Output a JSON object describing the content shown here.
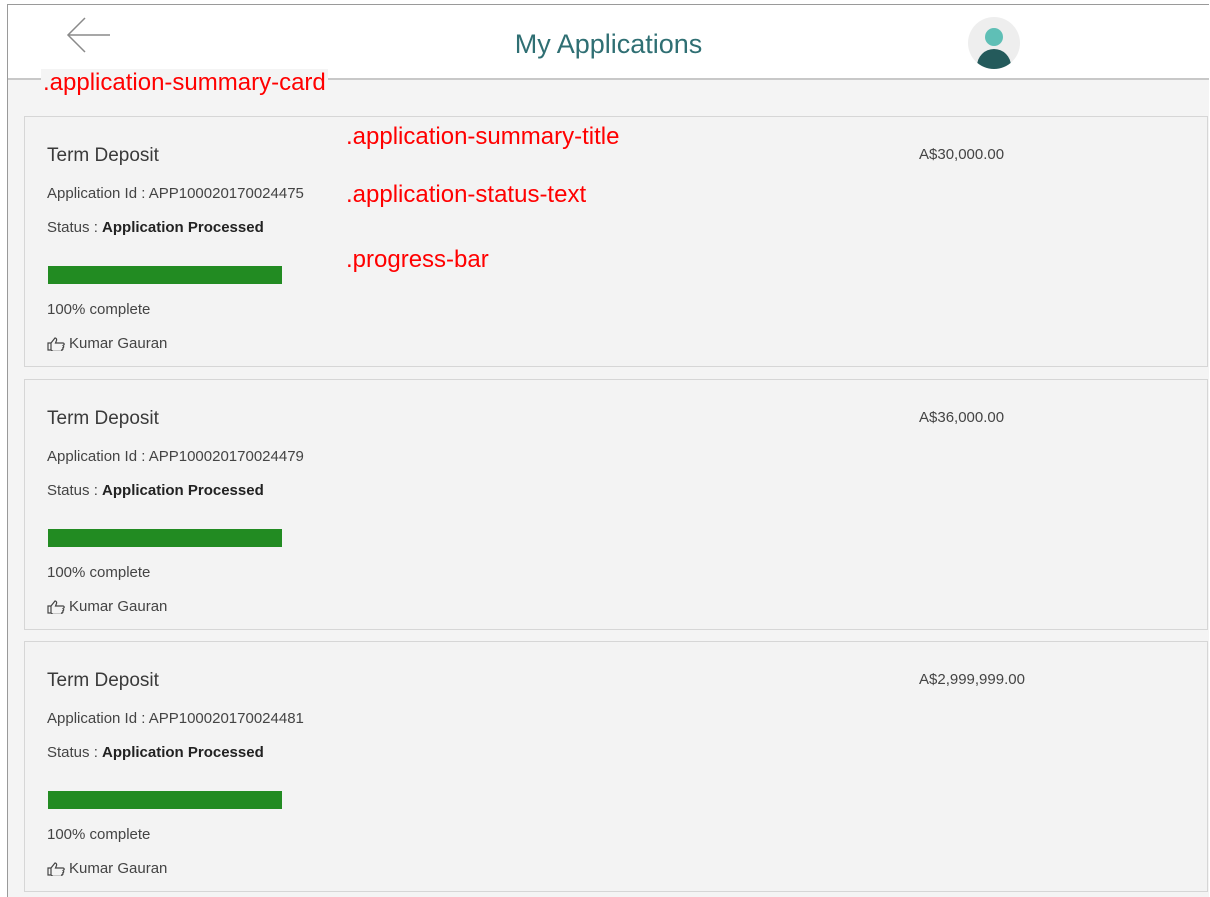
{
  "header": {
    "title": "My Applications",
    "back_icon": "arrow-left-icon",
    "avatar_icon": "user-avatar-icon"
  },
  "overlay_labels": {
    "card": ".application-summary-card",
    "title": ".application-summary-title",
    "status": ".application-status-text",
    "progress": ".progress-bar"
  },
  "applications": [
    {
      "title": "Term Deposit",
      "id_label": "Application Id : ",
      "id": "APP100020170024475",
      "status_label": "Status : ",
      "status": "Application Processed",
      "progress": 1.0,
      "progress_text": "100% complete",
      "assignee": "Kumar Gauran",
      "amount": "A$30,000.00"
    },
    {
      "title": "Term Deposit",
      "id_label": "Application Id : ",
      "id": "APP100020170024479",
      "status_label": "Status : ",
      "status": "Application Processed",
      "progress": 1.0,
      "progress_text": "100% complete",
      "assignee": "Kumar Gauran",
      "amount": "A$36,000.00"
    },
    {
      "title": "Term Deposit",
      "id_label": "Application Id : ",
      "id": "APP100020170024481",
      "status_label": "Status : ",
      "status": "Application Processed",
      "progress": 1.0,
      "progress_text": "100% complete",
      "assignee": "Kumar Gauran",
      "amount": "A$2,999,999.00"
    }
  ],
  "colors": {
    "title": "#2f6f73",
    "progress": "#228b22",
    "annotation": "#ff0000"
  }
}
